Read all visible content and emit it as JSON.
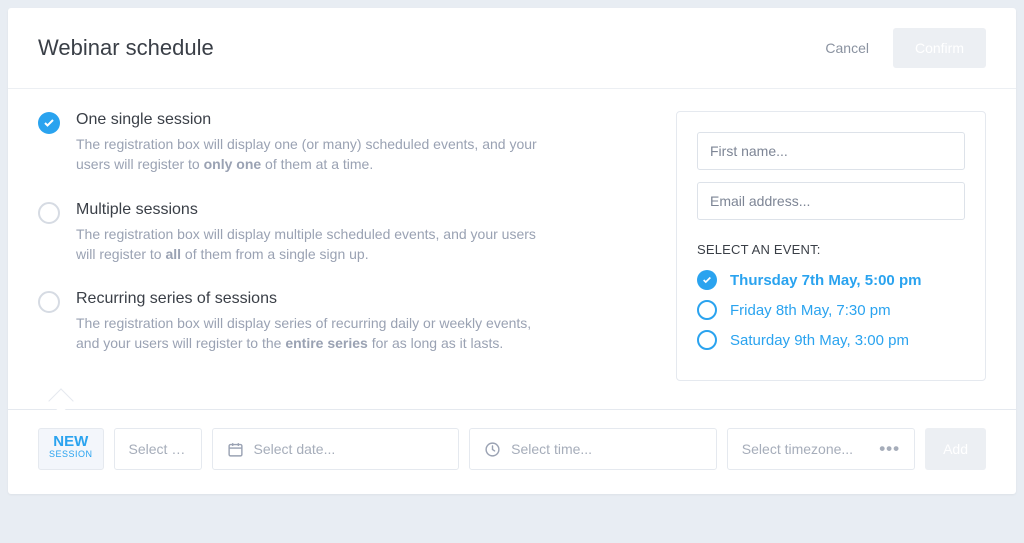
{
  "header": {
    "title": "Webinar schedule",
    "cancel": "Cancel",
    "confirm": "Confirm"
  },
  "options": [
    {
      "title": "One single session",
      "desc_a": "The registration box will display one (or many) scheduled events, and your users will register to ",
      "desc_b": "only one",
      "desc_c": " of them at a time.",
      "selected": true
    },
    {
      "title": "Multiple sessions",
      "desc_a": "The registration box will display multiple scheduled events, and your users will register to ",
      "desc_b": "all",
      "desc_c": " of them from a single sign up.",
      "selected": false
    },
    {
      "title": "Recurring series of sessions",
      "desc_a": "The registration box will display series of recurring daily or weekly events, and your users will register to the ",
      "desc_b": "entire series",
      "desc_c": " for as long as it lasts.",
      "selected": false
    }
  ],
  "preview": {
    "first_name_ph": "First name...",
    "email_ph": "Email address...",
    "select_label": "SELECT AN EVENT:",
    "events": [
      {
        "label": "Thursday 7th May, 5:00 pm",
        "selected": true
      },
      {
        "label": "Friday 8th May, 7:30 pm",
        "selected": false
      },
      {
        "label": "Saturday 9th May, 3:00 pm",
        "selected": false
      }
    ]
  },
  "footer": {
    "new_big": "NEW",
    "new_small": "SESSION",
    "item_ph": "Select it...",
    "date_ph": "Select date...",
    "time_ph": "Select time...",
    "tz_ph": "Select timezone...",
    "add": "Add"
  }
}
